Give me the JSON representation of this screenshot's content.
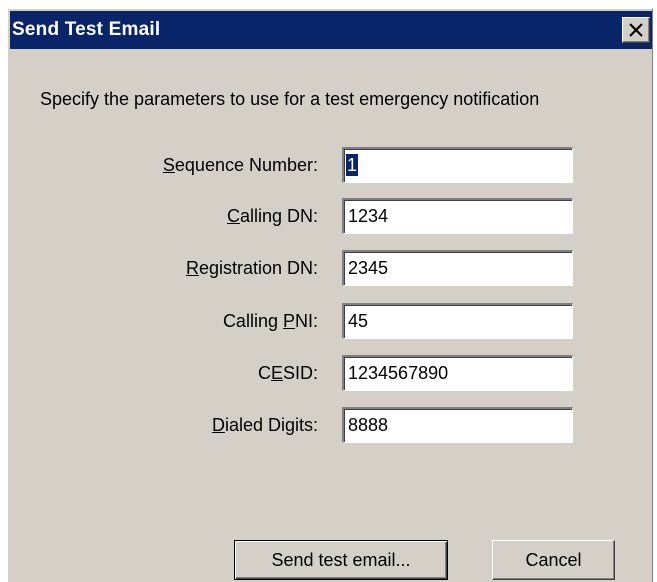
{
  "window": {
    "title": "Send Test Email",
    "close_icon": "close-x-icon"
  },
  "description": "Specify the parameters to use for a test emergency notification",
  "fields": [
    {
      "label_pre": "",
      "label_key": "S",
      "label_post": "equence Number:",
      "value": "1"
    },
    {
      "label_pre": "",
      "label_key": "C",
      "label_post": "alling DN:",
      "value": "1234"
    },
    {
      "label_pre": "",
      "label_key": "R",
      "label_post": "egistration DN:",
      "value": "2345"
    },
    {
      "label_pre": "Calling ",
      "label_key": "P",
      "label_post": "NI:",
      "value": "45"
    },
    {
      "label_pre": "C",
      "label_key": "E",
      "label_post": "SID:",
      "value": "1234567890"
    },
    {
      "label_pre": "",
      "label_key": "D",
      "label_post": "ialed Digits:",
      "value": "8888"
    }
  ],
  "buttons": {
    "send_label": "Send test email...",
    "cancel_label": "Cancel"
  },
  "colors": {
    "titlebar": "#0a246a",
    "dialog_bg": "#d4d0c8",
    "selection": "#0a246a"
  }
}
